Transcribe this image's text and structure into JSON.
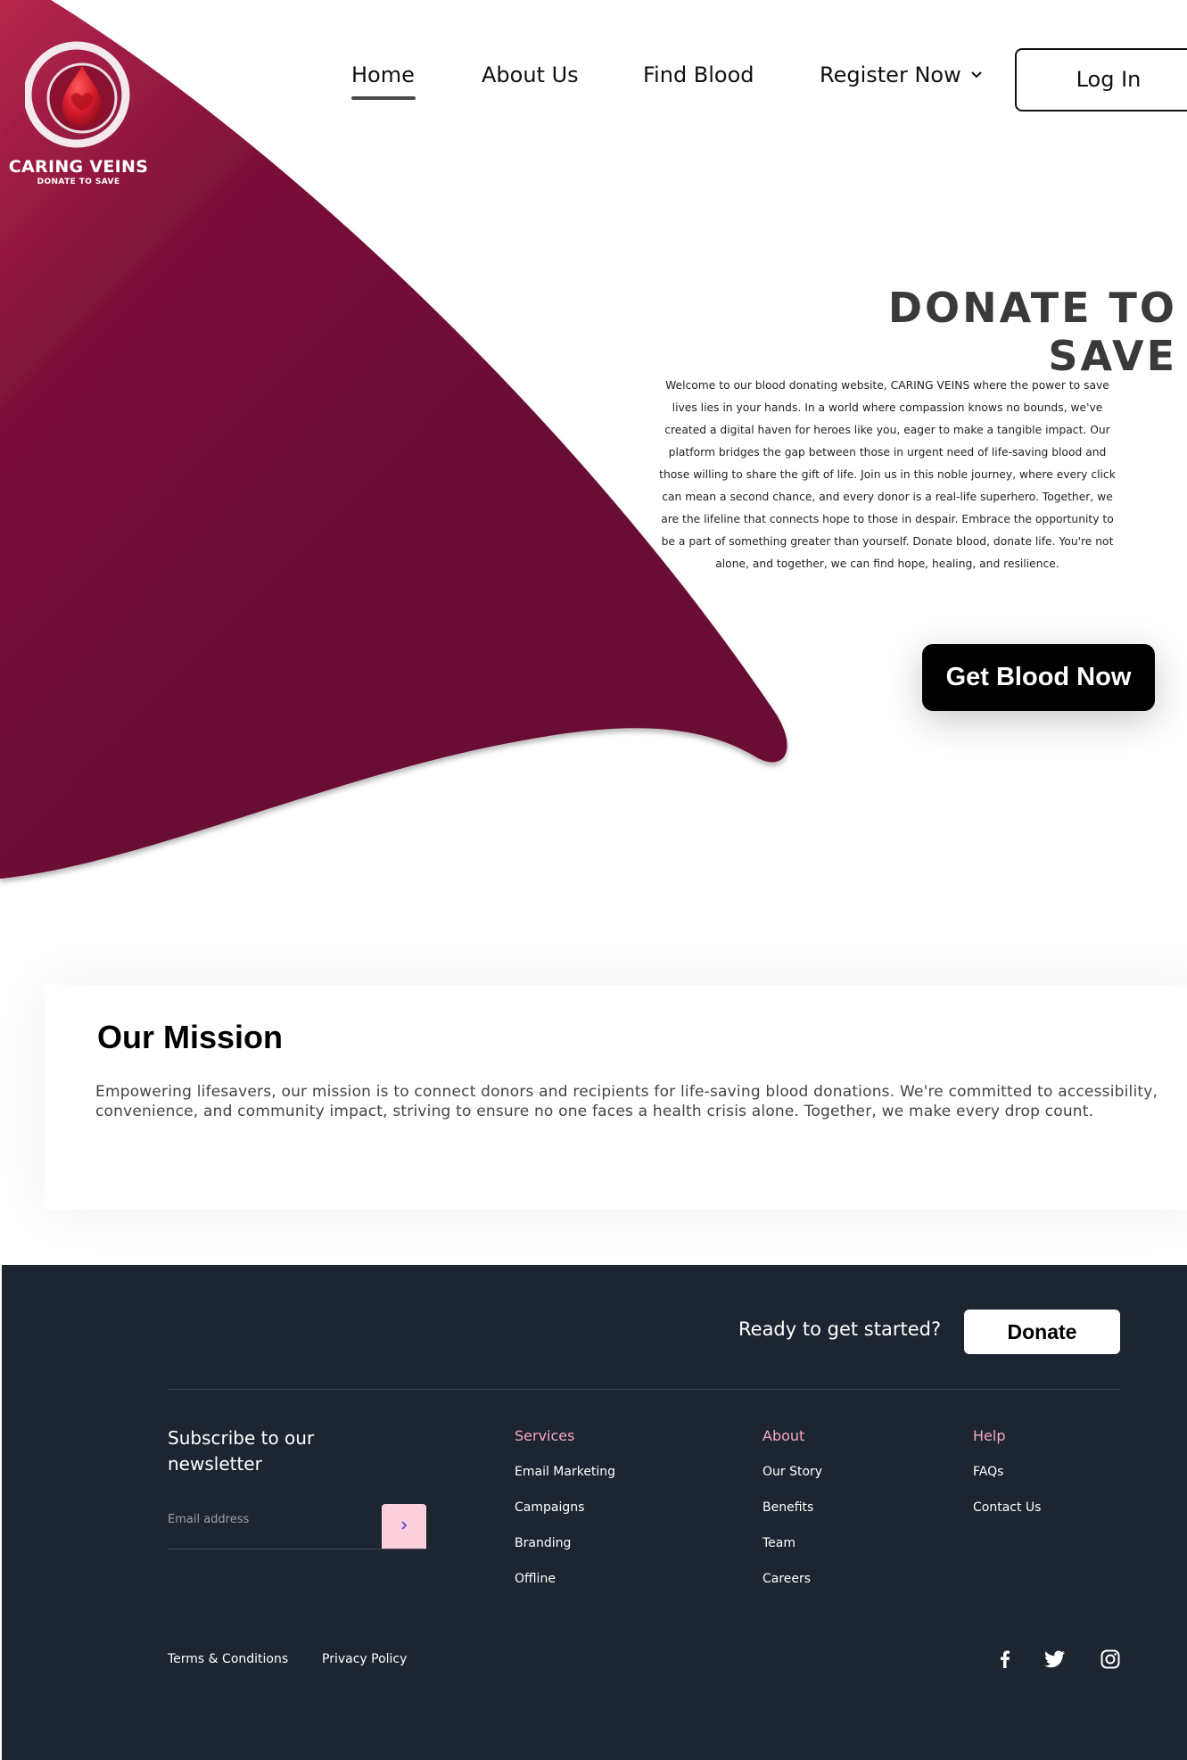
{
  "brand": {
    "name": "CARING VEINS",
    "tagline": "DONATE TO SAVE",
    "accent_color": "#7a1038",
    "logo_icon": "blood-drop-heart-icon"
  },
  "nav": {
    "items": [
      {
        "label": "Home",
        "active": true
      },
      {
        "label": "About Us",
        "active": false
      },
      {
        "label": "Find Blood",
        "active": false
      },
      {
        "label": "Register Now",
        "active": false
      }
    ],
    "register_icon": "chevron-down-icon",
    "login_label": "Log In"
  },
  "hero": {
    "title": "DONATE TO SAVE",
    "body": "Welcome to our blood donating website, CARING VEINS where the power to save lives lies in your hands. In a world where compassion knows no bounds, we've created a digital haven for heroes like you, eager to make a tangible impact. Our platform bridges the gap between those in urgent need of life-saving blood and those willing to share the gift of life. Join us in this noble journey, where every click can mean a second chance, and every donor is a real-life superhero. Together, we are the lifeline that connects hope to those in despair. Embrace the opportunity to be a part of something greater than yourself. Donate blood, donate life. You're not alone, and together, we can find hope, healing, and resilience.",
    "cta_label": "Get Blood Now"
  },
  "mission": {
    "title": "Our Mission",
    "text": "Empowering lifesavers, our mission is to connect donors and recipients for life-saving blood donations. We're committed to accessibility, convenience, and community impact, striving to ensure no one faces a health crisis alone. Together, we make every drop count."
  },
  "footer": {
    "ready_text": "Ready to get started?",
    "donate_label": "Donate",
    "newsletter_title": "Subscribe to our newsletter",
    "email_placeholder": "Email address",
    "submit_icon": "chevron-right-icon",
    "columns": [
      {
        "heading": "Services",
        "links": [
          "Email Marketing",
          "Campaigns",
          "Branding",
          "Offline"
        ]
      },
      {
        "heading": "About",
        "links": [
          "Our Story",
          "Benefits",
          "Team",
          "Careers"
        ]
      },
      {
        "heading": "Help",
        "links": [
          "FAQs",
          "Contact Us"
        ]
      }
    ],
    "bottom_links": [
      "Terms & Conditions",
      "Privacy Policy"
    ],
    "social_icons": [
      "facebook-icon",
      "twitter-icon",
      "instagram-icon"
    ],
    "background_color": "#1d2530",
    "heading_color": "#f6a7c2"
  }
}
